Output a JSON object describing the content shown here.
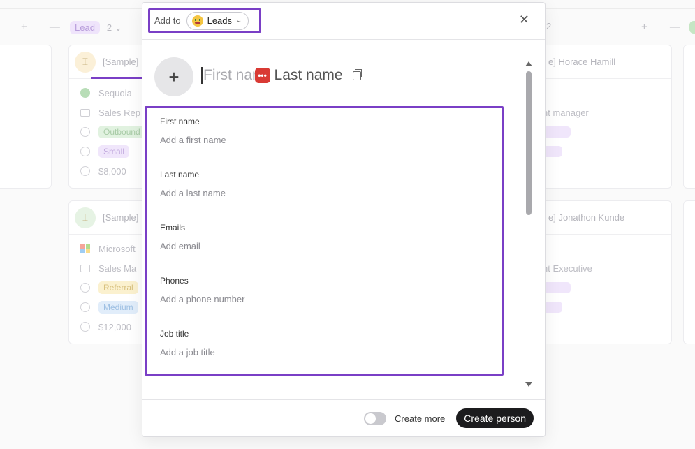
{
  "board": {
    "col1_tools": "+ —",
    "col2_tag": "Lead",
    "col2_count": "2 ⌄",
    "col3_count": "2",
    "col3_tools": "+ —",
    "cards_left": [
      {
        "title": "[Sample] ...",
        "company": "Sequoia",
        "role": "Sales Rep",
        "source": "Outbound",
        "size": "Small",
        "value": "$8,000"
      },
      {
        "title": "[Sample] ...",
        "company": "Microsoft",
        "role": "Sales Ma",
        "source": "Referral",
        "size": "Medium",
        "value": "$12,000"
      }
    ],
    "cards_right": [
      {
        "title": "e] Horace Hamill",
        "role": "nt manager"
      },
      {
        "title": "e] Jonathon Kunde",
        "role": "nt Executive"
      }
    ]
  },
  "modal": {
    "add_to_label": "Add to",
    "list_name": "Leads",
    "list_icon": "money-mouth-face-emoji",
    "close_icon": "close-icon",
    "name": {
      "first_placeholder": "First nam",
      "last_placeholder": "Last name",
      "badge": "•••"
    },
    "fields": [
      {
        "label": "First name",
        "placeholder": "Add a first name"
      },
      {
        "label": "Last name",
        "placeholder": "Add a last name"
      },
      {
        "label": "Emails",
        "placeholder": "Add email"
      },
      {
        "label": "Phones",
        "placeholder": "Add a phone number"
      },
      {
        "label": "Job title",
        "placeholder": "Add a job title"
      }
    ],
    "footer": {
      "create_more_label": "Create more",
      "create_more_on": false,
      "create_button": "Create person"
    }
  },
  "colors": {
    "annotation": "#7a3fc6",
    "primary_button": "#1c1c1e",
    "badge_red": "#d93a34"
  }
}
